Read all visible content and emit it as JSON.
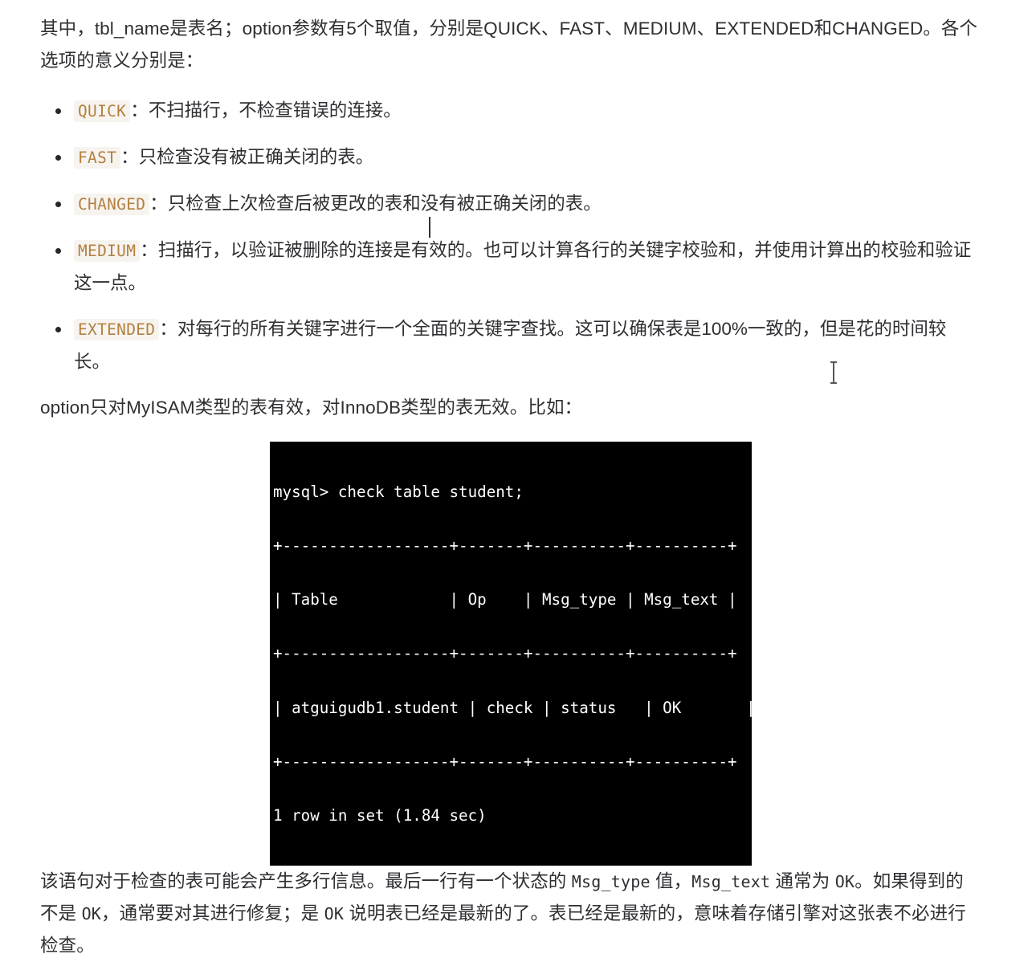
{
  "document": {
    "intro_paragraph": {
      "before_code": "其中，",
      "code_1": "tbl_name",
      "middle": "是表名；",
      "code_2": "option",
      "after": "参数有5个取值，分别是QUICK、FAST、MEDIUM、EXTENDED和CHANGED。各个选项的意义分别是："
    },
    "options": [
      {
        "name": "QUICK",
        "separator": "：",
        "description": "不扫描行，不检查错误的连接。"
      },
      {
        "name": "FAST",
        "separator": "：",
        "description": "只检查没有被正确关闭的表。"
      },
      {
        "name": "CHANGED",
        "separator": "：",
        "description": "只检查上次检查后被更改的表和没有被正确关闭的表。"
      },
      {
        "name": "MEDIUM",
        "separator": "：",
        "description": "扫描行，以验证被删除的连接是有效的。也可以计算各行的关键字校验和，并使用计算出的校验和验证这一点。"
      },
      {
        "name": "EXTENDED",
        "separator": "：",
        "description": "对每行的所有关键字进行一个全面的关键字查找。这可以确保表是100%一致的，但是花的时间较长。"
      }
    ],
    "option_paragraph": "option只对MyISAM类型的表有效，对InnoDB类型的表无效。比如：",
    "terminal": {
      "background_color": "#000000",
      "text_color": "#ffffff",
      "lines": [
        "mysql> check table student;",
        "+------------------+-------+----------+----------+",
        "| Table            | Op    | Msg_type | Msg_text |",
        "+------------------+-------+----------+----------+",
        "| atguigudb1.student | check | status   | OK       |",
        "+------------------+-------+----------+----------+",
        "1 row in set (1.84 sec)"
      ]
    },
    "tail_paragraph": {
      "seg_1": "该语句对于检查的表可能会产生多行信息。最后一行有一个状态的 ",
      "code_1": "Msg_type",
      "seg_2": " 值，",
      "code_2": "Msg_text",
      "seg_3": " 通常为 ",
      "code_3": "OK",
      "seg_4": "。如果得到的不是 ",
      "code_4": "OK",
      "seg_5": "，通常要对其进行修复；是 ",
      "code_5": "OK",
      "seg_6": " 说明表已经是最新的了。表已经是最新的，意味着存储引擎对这张表不必进行检查。"
    }
  },
  "colors": {
    "inline_code_text": "#b3813f",
    "inline_code_background": "#f7f4f0",
    "body_text": "#2f2f33",
    "page_background": "#ffffff"
  }
}
